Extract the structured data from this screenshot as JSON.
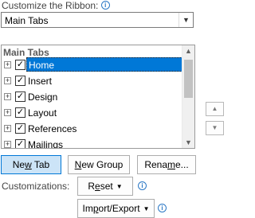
{
  "ribbon": {
    "customize_label": "Customize the Ribbon:",
    "info_icon": "info-icon",
    "combo_value": "Main Tabs"
  },
  "tree": {
    "header": "Main Tabs",
    "items": [
      {
        "label": "Home",
        "checked": true,
        "selected": true
      },
      {
        "label": "Insert",
        "checked": true,
        "selected": false
      },
      {
        "label": "Design",
        "checked": true,
        "selected": false
      },
      {
        "label": "Layout",
        "checked": true,
        "selected": false
      },
      {
        "label": "References",
        "checked": true,
        "selected": false
      },
      {
        "label": "Mailings",
        "checked": true,
        "selected": false
      }
    ],
    "expand_glyph": "+",
    "check_glyph": "✓",
    "selection_color": "#0078d7"
  },
  "buttons": {
    "new_tab_pre": "Ne",
    "new_tab_acc": "w",
    "new_tab_post": " Tab",
    "new_group_acc": "N",
    "new_group_post": "ew Group",
    "rename_pre": "Rena",
    "rename_acc": "m",
    "rename_post": "e...",
    "move_up_icon": "triangle-up-icon",
    "move_down_icon": "triangle-down-icon"
  },
  "customizations": {
    "label": "Customizations:",
    "reset_pre": "R",
    "reset_acc": "e",
    "reset_post": "set",
    "import_export_pre": "Im",
    "import_export_acc": "p",
    "import_export_post": "ort/Export"
  }
}
